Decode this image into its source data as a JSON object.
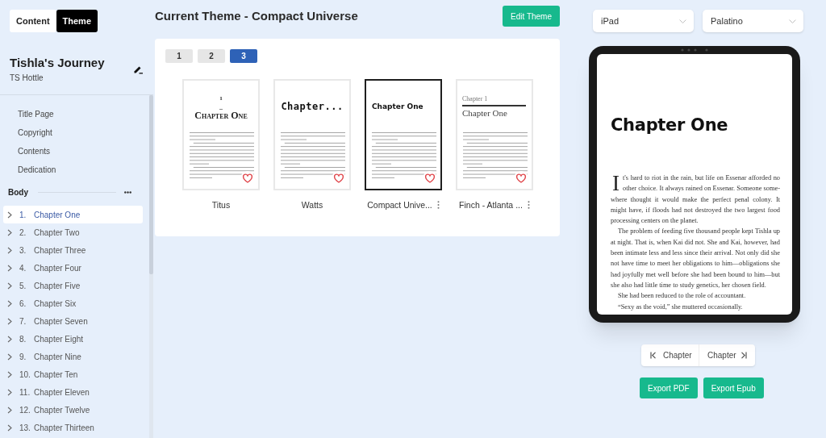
{
  "mode_tabs": [
    {
      "label": "Content",
      "selected": false
    },
    {
      "label": "Theme",
      "selected": true
    }
  ],
  "book": {
    "title": "Tishla's Journey",
    "author": "TS Hottle"
  },
  "front_matter": [
    {
      "label": "Title Page",
      "selected": false
    },
    {
      "label": "Copyright",
      "selected": false
    },
    {
      "label": "Contents",
      "selected": false
    },
    {
      "label": "Dedication",
      "selected": false
    }
  ],
  "body_section": {
    "label": "Body"
  },
  "chapters": [
    {
      "number": "1.",
      "title": "Chapter One",
      "selected": true,
      "expanded": false
    },
    {
      "number": "2.",
      "title": "Chapter Two",
      "selected": false,
      "expanded": false
    },
    {
      "number": "3.",
      "title": "Chapter Three",
      "selected": false,
      "expanded": false
    },
    {
      "number": "4.",
      "title": "Chapter Four",
      "selected": false,
      "expanded": false
    },
    {
      "number": "5.",
      "title": "Chapter Five",
      "selected": false,
      "expanded": false
    },
    {
      "number": "6.",
      "title": "Chapter Six",
      "selected": false,
      "expanded": false
    },
    {
      "number": "7.",
      "title": "Chapter Seven",
      "selected": false,
      "expanded": false
    },
    {
      "number": "8.",
      "title": "Chapter Eight",
      "selected": false,
      "expanded": false
    },
    {
      "number": "9.",
      "title": "Chapter Nine",
      "selected": false,
      "expanded": false
    },
    {
      "number": "10.",
      "title": "Chapter Ten",
      "selected": false,
      "expanded": false
    },
    {
      "number": "11.",
      "title": "Chapter Eleven",
      "selected": false,
      "expanded": false
    },
    {
      "number": "12.",
      "title": "Chapter Twelve",
      "selected": false,
      "expanded": false
    },
    {
      "number": "13.",
      "title": "Chapter Thirteen",
      "selected": false,
      "expanded": false
    }
  ],
  "theme_header": {
    "title": "Current Theme - Compact Universe",
    "edit_button": "Edit Theme"
  },
  "theme_pages": [
    {
      "label": "1",
      "selected": false
    },
    {
      "label": "2",
      "selected": false
    },
    {
      "label": "3",
      "selected": true
    }
  ],
  "themes": [
    {
      "name": "Titus",
      "selected": false,
      "favorite": false,
      "menu": false,
      "preview": {
        "kind": "numbered",
        "number": "1",
        "heading": "Chapter One"
      }
    },
    {
      "name": "Watts",
      "selected": false,
      "favorite": false,
      "menu": false,
      "preview": {
        "kind": "mono",
        "heading": "Chapter..."
      }
    },
    {
      "name": "Compact Unive...",
      "selected": true,
      "favorite": false,
      "menu": true,
      "preview": {
        "kind": "heavy",
        "heading": "Chapter One"
      }
    },
    {
      "name": "Finch - Atlanta ...",
      "selected": false,
      "favorite": false,
      "menu": true,
      "preview": {
        "kind": "ruled",
        "label": "Chapter 1",
        "heading": "Chapter One"
      }
    }
  ],
  "device_select": {
    "value": "iPad"
  },
  "font_select": {
    "value": "Palatino"
  },
  "preview": {
    "heading": "Chapter One",
    "paragraphs": [
      {
        "drop_cap": "I",
        "text": "t's hard to riot in the rain, but life on Essenar afforded no other choice. It always rained on Essenar. Someone some-where thought it would make the perfect penal colony. It might have, if floods had not destroyed the two largest food processing centers on the planet."
      },
      {
        "text": "The problem of feeding five thousand people kept Tishla up at night. That is, when Kai did not. She and Kai, however, had been intimate less and less since their arrival. Not only did she not have time to meet her obligations to him—obligations she had joyfully met well before she had been bound to him—but she also had little time to study genetics, her chosen field."
      },
      {
        "text": "She had been reduced to the role of accountant."
      },
      {
        "text": "“Sexy as the void,” she muttered occasionally."
      }
    ]
  },
  "chapter_nav": {
    "previous": "Chapter",
    "next": "Chapter"
  },
  "export_buttons": [
    {
      "label": "Export PDF"
    },
    {
      "label": "Export Epub"
    }
  ]
}
